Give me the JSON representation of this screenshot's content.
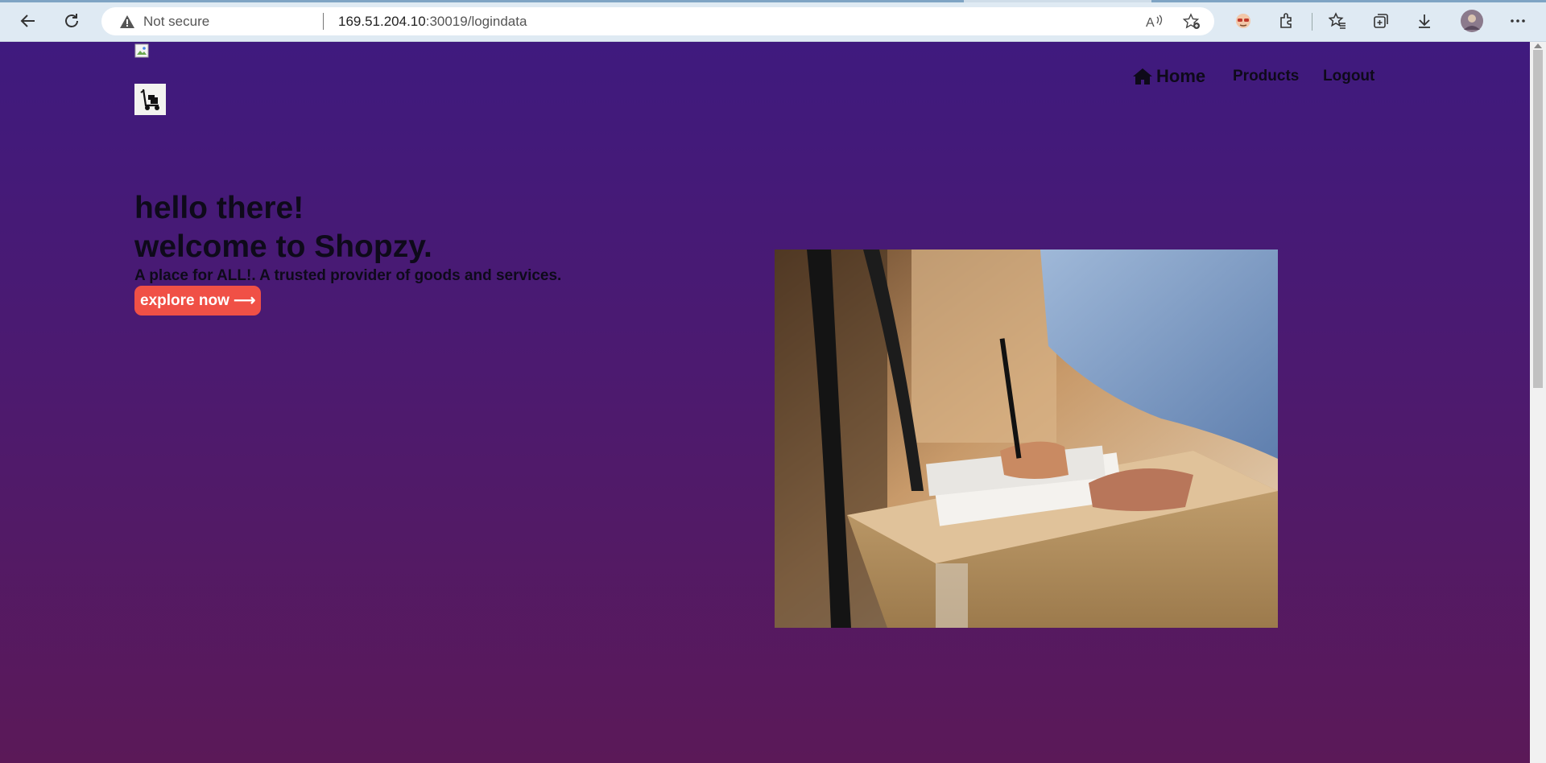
{
  "browser": {
    "security_label": "Not secure",
    "url_host": "169.51.204.10",
    "url_path": ":30019/logindata",
    "icons": [
      "back-icon",
      "reload-icon",
      "warning-icon",
      "read-aloud-icon",
      "add-favorite-icon",
      "profile-extension-icon",
      "extensions-icon",
      "favorites-icon",
      "collections-icon",
      "downloads-icon",
      "avatar",
      "more-icon"
    ]
  },
  "nav": {
    "home_label": "Home",
    "products_label": "Products",
    "logout_label": "Logout"
  },
  "hero": {
    "line1": "hello there!",
    "line2": "welcome to Shopzy.",
    "tagline": "A place for ALL!. A trusted provider of goods and services.",
    "cta_label": "explore now ⟶"
  },
  "colors": {
    "gradient_top": "#3f1a7e",
    "gradient_bottom": "#5b1958",
    "cta_bg": "#f05046",
    "text_dark": "#0e0a1a"
  }
}
